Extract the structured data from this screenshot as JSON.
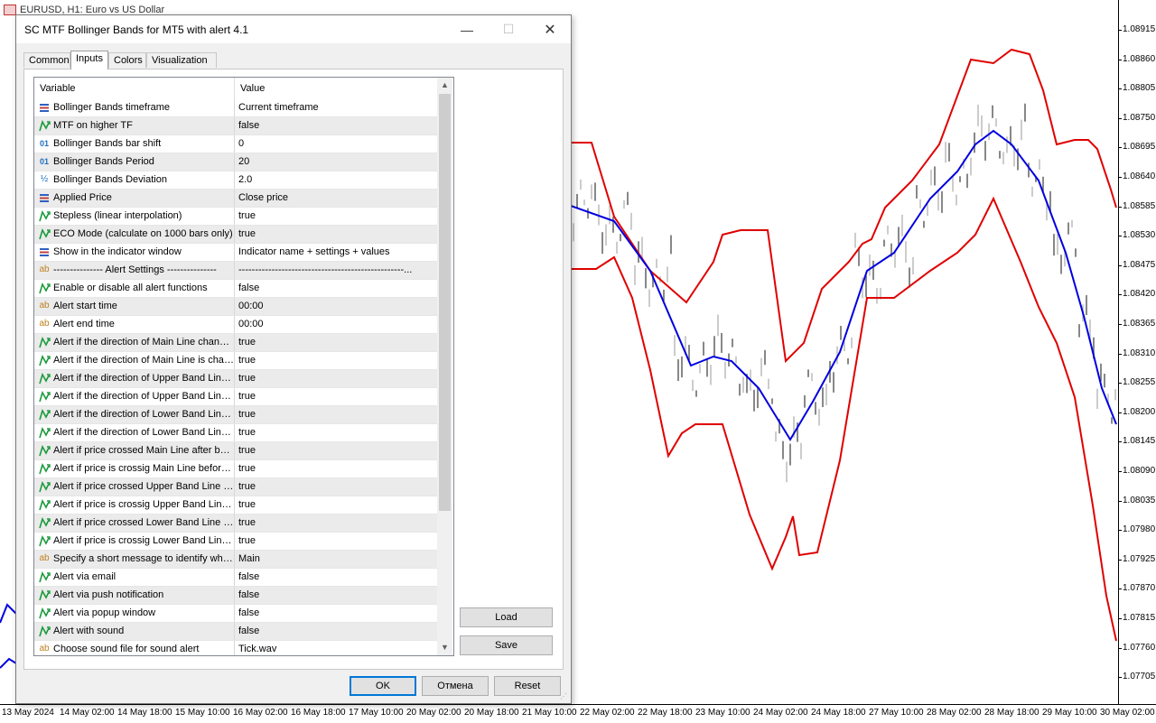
{
  "chart": {
    "title": "EURUSD, H1: Euro vs US Dollar",
    "price_labels": [
      "1.08915",
      "1.08860",
      "1.08805",
      "1.08750",
      "1.08695",
      "1.08640",
      "1.08585",
      "1.08530",
      "1.08475",
      "1.08420",
      "1.08365",
      "1.08310",
      "1.08255",
      "1.08200",
      "1.08145",
      "1.08090",
      "1.08035",
      "1.07980",
      "1.07925",
      "1.07870",
      "1.07815",
      "1.07760",
      "1.07705"
    ],
    "time_labels": [
      "13 May 2024",
      "14 May 02:00",
      "14 May 18:00",
      "15 May 10:00",
      "16 May 02:00",
      "16 May 18:00",
      "17 May 10:00",
      "20 May 02:00",
      "20 May 18:00",
      "21 May 10:00",
      "22 May 02:00",
      "22 May 18:00",
      "23 May 10:00",
      "24 May 02:00",
      "24 May 18:00",
      "27 May 10:00",
      "28 May 02:00",
      "28 May 18:00",
      "29 May 10:00",
      "30 May 02:00"
    ],
    "colors": {
      "upper_band": "#e00000",
      "lower_band": "#e00000",
      "main_line": "#0000e0",
      "candles": "#888888"
    }
  },
  "dialog": {
    "title": "SC MTF Bollinger Bands for MT5 with alert 4.1",
    "tabs": [
      "Common",
      "Inputs",
      "Colors",
      "Visualization"
    ],
    "active_tab": "Inputs",
    "grid": {
      "headers": {
        "variable": "Variable",
        "value": "Value"
      },
      "rows": [
        {
          "icon": "enum",
          "variable": "Bollinger Bands timeframe",
          "value": "Current timeframe"
        },
        {
          "icon": "bool",
          "variable": "MTF on higher TF",
          "value": "false"
        },
        {
          "icon": "int",
          "variable": "Bollinger Bands bar shift",
          "value": "0"
        },
        {
          "icon": "int",
          "variable": "Bollinger Bands Period",
          "value": "20"
        },
        {
          "icon": "double",
          "variable": "Bollinger Bands Deviation",
          "value": "2.0"
        },
        {
          "icon": "enum",
          "variable": "Applied Price",
          "value": "Close price"
        },
        {
          "icon": "bool",
          "variable": "Stepless (linear interpolation)",
          "value": "true"
        },
        {
          "icon": "bool",
          "variable": "ECO Mode (calculate on 1000 bars only)",
          "value": "true"
        },
        {
          "icon": "enum",
          "variable": "Show in the indicator window",
          "value": "Indicator name + settings + values"
        },
        {
          "icon": "string",
          "variable": "--------------- Alert Settings ---------------",
          "value": "--------------------------------------------------..."
        },
        {
          "icon": "bool",
          "variable": "Enable or disable all alert functions",
          "value": "false"
        },
        {
          "icon": "string",
          "variable": "Alert start time",
          "value": "00:00"
        },
        {
          "icon": "string",
          "variable": "Alert end time",
          "value": "00:00"
        },
        {
          "icon": "bool",
          "variable": "Alert if the direction of Main Line changes",
          "value": "true"
        },
        {
          "icon": "bool",
          "variable": "Alert if the direction of Main Line is changing",
          "value": "true"
        },
        {
          "icon": "bool",
          "variable": "Alert if the direction of Upper Band Line changes",
          "value": "true"
        },
        {
          "icon": "bool",
          "variable": "Alert if the direction of Upper Band Line is changing",
          "value": "true"
        },
        {
          "icon": "bool",
          "variable": "Alert if the direction of Lower Band Line changes",
          "value": "true"
        },
        {
          "icon": "bool",
          "variable": "Alert if the direction of Lower Band Line is changing",
          "value": "true"
        },
        {
          "icon": "bool",
          "variable": "Alert if price crossed Main Line after bar closed",
          "value": "true"
        },
        {
          "icon": "bool",
          "variable": "Alert if price is crossig Main Line before bar closed",
          "value": "true"
        },
        {
          "icon": "bool",
          "variable": "Alert if price crossed Upper Band Line after bar closed",
          "value": "true"
        },
        {
          "icon": "bool",
          "variable": "Alert if price is crossig Upper Band Line before bar closed",
          "value": "true"
        },
        {
          "icon": "bool",
          "variable": "Alert if price crossed Lower Band Line after bar closed",
          "value": "true"
        },
        {
          "icon": "bool",
          "variable": "Alert if price is crossig Lower Band Line before bar closed",
          "value": "true"
        },
        {
          "icon": "string",
          "variable": "Specify a short message to identify which alert",
          "value": "Main"
        },
        {
          "icon": "bool",
          "variable": "Alert via email",
          "value": "false"
        },
        {
          "icon": "bool",
          "variable": "Alert via push notification",
          "value": "false"
        },
        {
          "icon": "bool",
          "variable": "Alert via popup window",
          "value": "false"
        },
        {
          "icon": "bool",
          "variable": "Alert with sound",
          "value": "false"
        },
        {
          "icon": "string",
          "variable": "Choose sound file for sound alert",
          "value": "Tick.wav"
        }
      ]
    },
    "buttons": {
      "load": "Load",
      "save": "Save",
      "ok": "OK",
      "cancel": "Отмена",
      "reset": "Reset"
    }
  }
}
